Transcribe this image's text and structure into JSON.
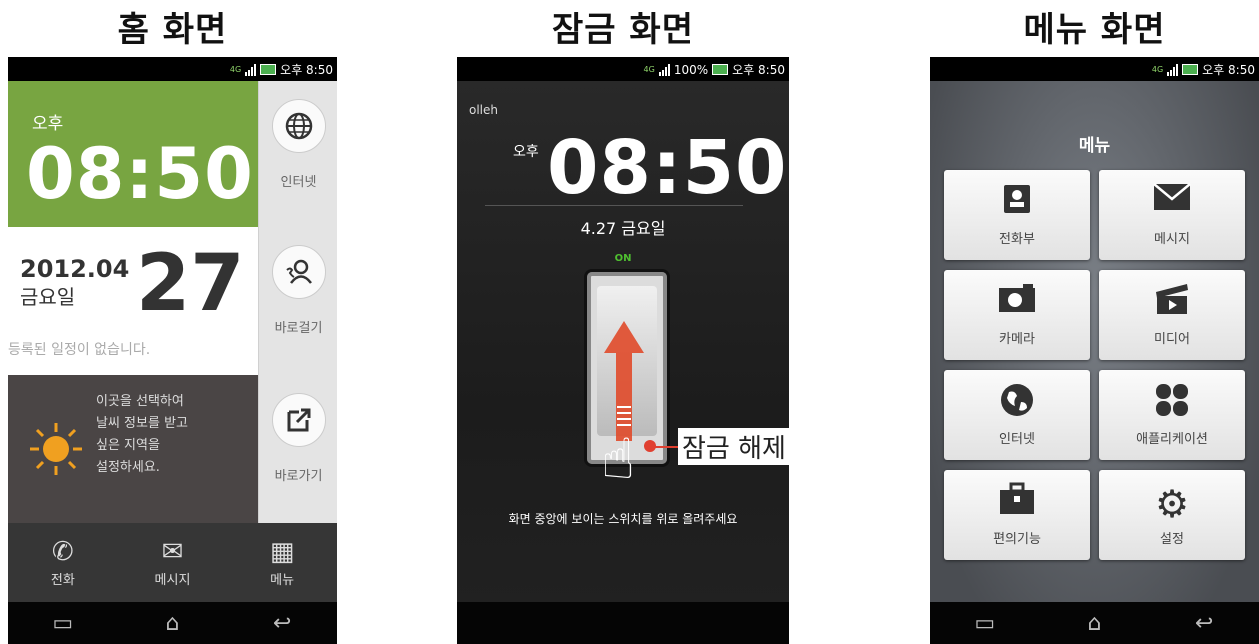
{
  "titles": {
    "home": "홈 화면",
    "lock": "잠금 화면",
    "menu": "메뉴 화면"
  },
  "status": {
    "home_time": "오후 8:50",
    "lock_battery": "100%",
    "lock_time": "오후 8:50",
    "menu_time": "오후 8:50",
    "network": "4G"
  },
  "home": {
    "ampm": "오후",
    "time": "08:50",
    "year_month": "2012.04",
    "weekday": "금요일",
    "day": "27",
    "no_schedule": "등록된 일정이 없습니다.",
    "weather_lines": [
      "이곳을 선택하여",
      "날씨 정보를 받고",
      "싶은 지역을",
      "설정하세요."
    ],
    "side": [
      {
        "label": "인터넷",
        "icon": "globe-icon"
      },
      {
        "label": "바로걸기",
        "icon": "contact-call-icon"
      },
      {
        "label": "바로가기",
        "icon": "shortcut-icon"
      }
    ],
    "dock": [
      {
        "label": "전화",
        "icon": "phone-icon"
      },
      {
        "label": "메시지",
        "icon": "envelope-icon"
      },
      {
        "label": "메뉴",
        "icon": "grid-icon"
      }
    ]
  },
  "lock": {
    "carrier": "olleh",
    "ampm": "오후",
    "time": "08:50",
    "date": "4.27 금요일",
    "on_label": "ON",
    "hint": "화면 중앙에 보이는 스위치를 위로 올려주세요",
    "unlock_label": "잠금 해제"
  },
  "menu": {
    "title": "메뉴",
    "items": [
      {
        "label": "전화부",
        "icon": "contacts-icon"
      },
      {
        "label": "메시지",
        "icon": "envelope-icon"
      },
      {
        "label": "카메라",
        "icon": "camera-icon"
      },
      {
        "label": "미디어",
        "icon": "clapperboard-icon"
      },
      {
        "label": "인터넷",
        "icon": "globe-icon"
      },
      {
        "label": "애플리케이션",
        "icon": "apps-icon"
      },
      {
        "label": "편의기능",
        "icon": "briefcase-icon"
      },
      {
        "label": "설정",
        "icon": "gear-icon"
      }
    ]
  }
}
